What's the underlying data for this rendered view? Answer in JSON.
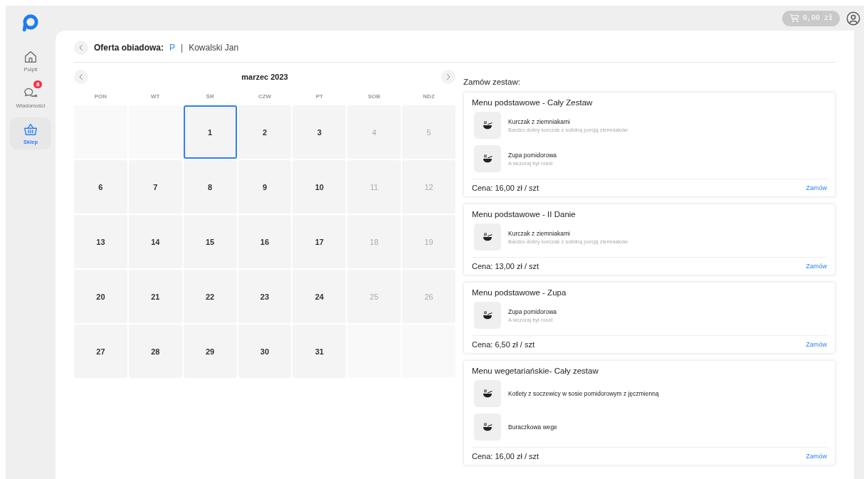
{
  "sidebar": {
    "items": [
      {
        "kind": "home",
        "label": "Pulpit",
        "selected": false
      },
      {
        "kind": "chat",
        "label": "Wiadomości",
        "selected": false,
        "badge": "8"
      },
      {
        "kind": "basket",
        "label": "Sklep",
        "selected": true
      }
    ]
  },
  "topbar": {
    "cart_total": "0,00 zł"
  },
  "header": {
    "title": "Oferta obiadowa:",
    "code": "P",
    "separator": "|",
    "person": "Kowalski Jan"
  },
  "calendar": {
    "month": "marzec 2023",
    "weekdays": [
      "PON",
      "WT",
      "ŚR",
      "CZW",
      "PT",
      "SOB",
      "NDZ"
    ],
    "weeks": [
      [
        {
          "kind": "empty"
        },
        {
          "kind": "empty"
        },
        {
          "kind": "day",
          "label": "1",
          "disabled": false,
          "selected": true
        },
        {
          "kind": "day",
          "label": "2",
          "disabled": false,
          "selected": false
        },
        {
          "kind": "day",
          "label": "3",
          "disabled": false,
          "selected": false
        },
        {
          "kind": "day",
          "label": "4",
          "disabled": true,
          "selected": false
        },
        {
          "kind": "day",
          "label": "5",
          "disabled": true,
          "selected": false
        }
      ],
      [
        {
          "kind": "day",
          "label": "6",
          "disabled": false,
          "selected": false
        },
        {
          "kind": "day",
          "label": "7",
          "disabled": false,
          "selected": false
        },
        {
          "kind": "day",
          "label": "8",
          "disabled": false,
          "selected": false
        },
        {
          "kind": "day",
          "label": "9",
          "disabled": false,
          "selected": false
        },
        {
          "kind": "day",
          "label": "10",
          "disabled": false,
          "selected": false
        },
        {
          "kind": "day",
          "label": "11",
          "disabled": true,
          "selected": false
        },
        {
          "kind": "day",
          "label": "12",
          "disabled": true,
          "selected": false
        }
      ],
      [
        {
          "kind": "day",
          "label": "13",
          "disabled": false,
          "selected": false
        },
        {
          "kind": "day",
          "label": "14",
          "disabled": false,
          "selected": false
        },
        {
          "kind": "day",
          "label": "15",
          "disabled": false,
          "selected": false
        },
        {
          "kind": "day",
          "label": "16",
          "disabled": false,
          "selected": false
        },
        {
          "kind": "day",
          "label": "17",
          "disabled": false,
          "selected": false
        },
        {
          "kind": "day",
          "label": "18",
          "disabled": true,
          "selected": false
        },
        {
          "kind": "day",
          "label": "19",
          "disabled": true,
          "selected": false
        }
      ],
      [
        {
          "kind": "day",
          "label": "20",
          "disabled": false,
          "selected": false
        },
        {
          "kind": "day",
          "label": "21",
          "disabled": false,
          "selected": false
        },
        {
          "kind": "day",
          "label": "22",
          "disabled": false,
          "selected": false
        },
        {
          "kind": "day",
          "label": "23",
          "disabled": false,
          "selected": false
        },
        {
          "kind": "day",
          "label": "24",
          "disabled": false,
          "selected": false
        },
        {
          "kind": "day",
          "label": "25",
          "disabled": true,
          "selected": false
        },
        {
          "kind": "day",
          "label": "26",
          "disabled": true,
          "selected": false
        }
      ],
      [
        {
          "kind": "day",
          "label": "27",
          "disabled": false,
          "selected": false
        },
        {
          "kind": "day",
          "label": "28",
          "disabled": false,
          "selected": false
        },
        {
          "kind": "day",
          "label": "29",
          "disabled": false,
          "selected": false
        },
        {
          "kind": "day",
          "label": "30",
          "disabled": false,
          "selected": false
        },
        {
          "kind": "day",
          "label": "31",
          "disabled": false,
          "selected": false
        },
        {
          "kind": "empty"
        },
        {
          "kind": "empty"
        }
      ]
    ]
  },
  "offers": {
    "heading": "Zamów zestaw:",
    "sets": [
      {
        "title": "Menu podstawowe - Cały Zestaw",
        "items": [
          {
            "name": "Kurczak z ziemniakami",
            "description": "Bardzo dobry kurczak z solidną porcją ziemniaków"
          },
          {
            "name": "Zupa pomidorowa",
            "description": "A wczoraj był rosół"
          }
        ],
        "price": "Cena: 16,00 zł / szt",
        "action": "Zamów"
      },
      {
        "title": "Menu podstawowe - II Danie",
        "items": [
          {
            "name": "Kurczak z ziemniakami",
            "description": "Bardzo dobry kurczak z solidną porcją ziemniaków"
          }
        ],
        "price": "Cena: 13,00 zł / szt",
        "action": "Zamów"
      },
      {
        "title": "Menu podstawowe - Zupa",
        "items": [
          {
            "name": "Zupa pomidorowa",
            "description": "A wczoraj był rosół"
          }
        ],
        "price": "Cena: 6,50 zł / szt",
        "action": "Zamów"
      },
      {
        "title": "Menu wegetariańskie- Cały zestaw",
        "items": [
          {
            "name": "Kotlety z soczewicy w sosie pomidorowym z jęczmienną"
          },
          {
            "name": "Buraczkowa wege"
          }
        ],
        "price": "Cena: 16,00 zł / szt",
        "action": "Zamów"
      }
    ]
  }
}
